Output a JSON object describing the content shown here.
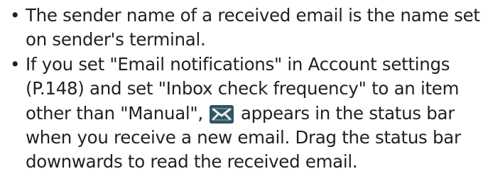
{
  "notes": {
    "bullet": "•",
    "items": [
      {
        "lines": [
          "The sender name of a received email is the name set",
          "on sender's terminal."
        ]
      },
      {
        "lines": [
          "If you set \"Email notifications\" in Account settings",
          "(P.148) and set \"Inbox check frequency\" to an item"
        ],
        "line3_before_icon": "other than \"Manual\",",
        "icon": "new-email-notification-icon",
        "line3_after_icon": "appears in the status bar",
        "lines_after": [
          "when you receive a new email. Drag the status bar",
          "downwards to read the received email."
        ]
      }
    ]
  },
  "colors": {
    "text": "#231f20",
    "icon_background": "#2f5561",
    "icon_mark": "#e8eef0"
  }
}
